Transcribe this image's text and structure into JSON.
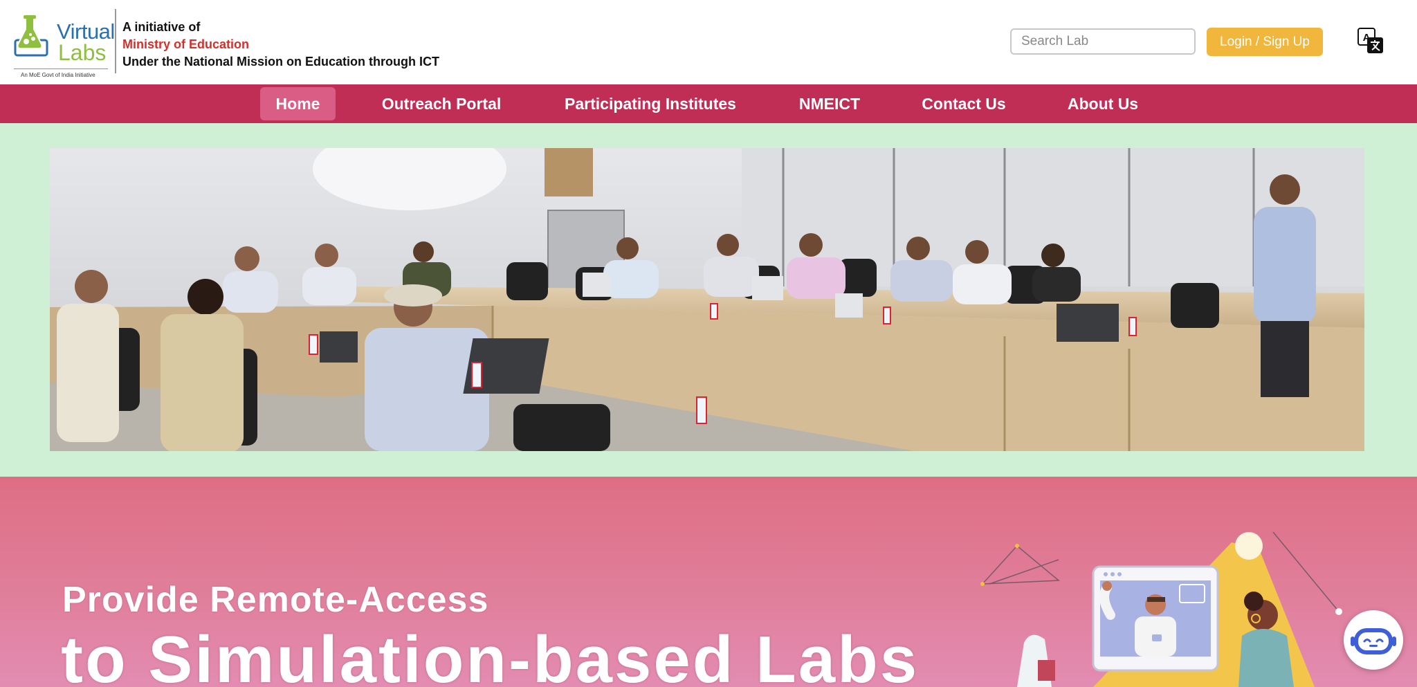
{
  "header": {
    "logo": {
      "word1": "Virtual",
      "word2": "Labs",
      "tagline": "An MoE Govt of India Initiative"
    },
    "initiative": {
      "line1": "A initiative of",
      "line2": "Ministry of Education",
      "line3": "Under the National Mission on Education through ICT"
    },
    "search": {
      "placeholder": "Search Lab",
      "value": ""
    },
    "login_label": "Login / Sign Up",
    "translate_icon": "translate-icon"
  },
  "nav": {
    "items": [
      {
        "label": "Home",
        "active": true
      },
      {
        "label": "Outreach Portal",
        "active": false
      },
      {
        "label": "Participating Institutes",
        "active": false
      },
      {
        "label": "NMEICT",
        "active": false
      },
      {
        "label": "Contact Us",
        "active": false
      },
      {
        "label": "About Us",
        "active": false
      }
    ]
  },
  "hero": {
    "photo_subject": "meeting-room-photo"
  },
  "banner": {
    "line1": "Provide Remote-Access",
    "line2": "to Simulation-based Labs"
  },
  "chatbot_icon": "chatbot-icon",
  "colors": {
    "nav_bg": "#c02e56",
    "nav_active": "#d95d84",
    "login_bg": "#f1b73c",
    "photo_band_bg": "#d0f0d6",
    "ministry_red": "#d0312d",
    "banner_top": "#de6e84",
    "banner_bottom": "#e38cb2"
  }
}
